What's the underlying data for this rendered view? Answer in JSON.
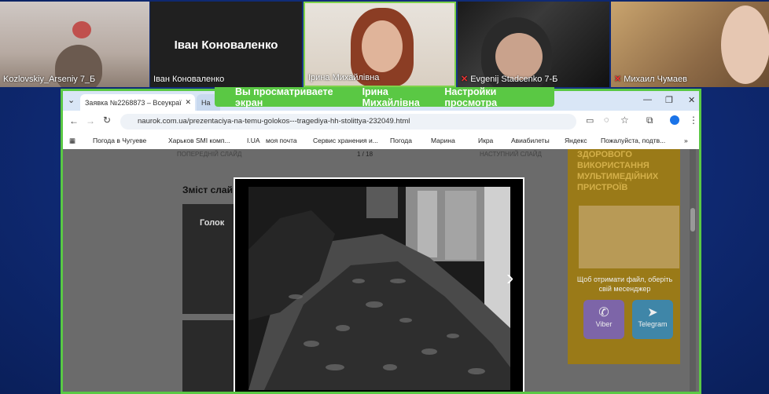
{
  "participants": [
    {
      "name": "Kozlovskiy_Arseniy 7_Б",
      "muted": false
    },
    {
      "name": "Іван Коноваленко",
      "muted": false,
      "video_off": true,
      "center_label": "Іван Коноваленко"
    },
    {
      "name": "Ірина Михайлівна",
      "muted": false,
      "active_speaker": true
    },
    {
      "name": "Evgenij Stadcenko 7-Б",
      "muted": true
    },
    {
      "name": "Михаил Чумаев",
      "muted": true
    }
  ],
  "share_banner": {
    "message": "Вы просматриваете экран",
    "presenter": "Ірина Михайлівна",
    "settings": "Настройки просмотра"
  },
  "browser": {
    "tabs": [
      {
        "title": "Заявка №2268873 – Всеукраї",
        "active": true
      },
      {
        "title": "На",
        "active": false
      }
    ],
    "url": "naurok.com.ua/prezentaciya-na-temu-golokos---tragediya-hh-stolittya-232049.html",
    "bookmarks": [
      "Погода в Чугуеве",
      "Харьков SMI комп...",
      "I.UA",
      "моя почта",
      "Сервис хранения и...",
      "Погода",
      "Марина",
      "Икра",
      "Авиабилеты",
      "Яндекс",
      "Пожалуйста, подтв..."
    ]
  },
  "page": {
    "prev_slide": "ПОПЕРЕДНІЙ СЛАЙД",
    "counter": "1 / 18",
    "next_slide": "НАСТУПНИЙ СЛАЙД",
    "content_heading": "Зміст слай",
    "card_text": "Голок",
    "sidebar_heading": "ЗДОРОВОГО ВИКОРИСТАННЯ МУЛЬТИМЕДІЙНИХ ПРИСТРОЇВ",
    "sidebar_prompt": "Щоб отримати файл, оберіть свій месенджер",
    "viber": "Viber",
    "telegram": "Telegram"
  }
}
